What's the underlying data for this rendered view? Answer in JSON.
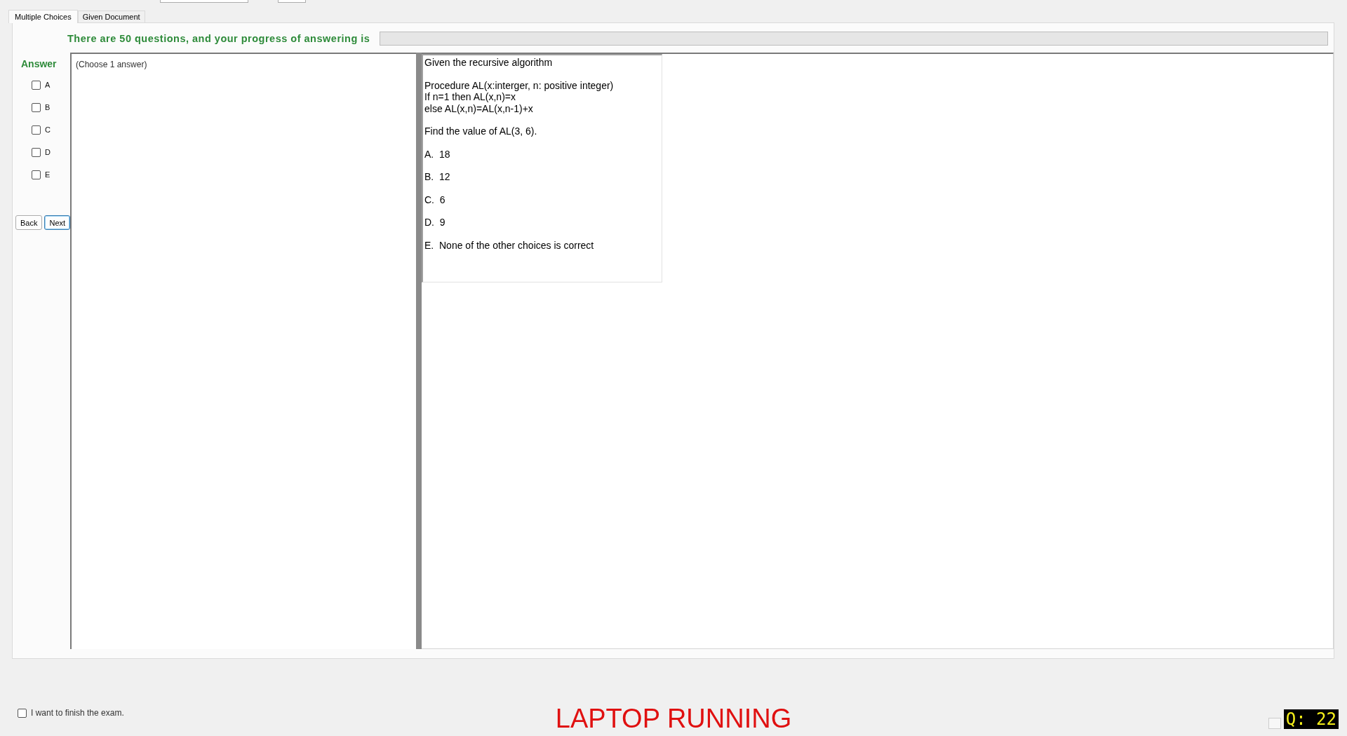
{
  "tabs": [
    {
      "label": "Multiple Choices",
      "selected": true
    },
    {
      "label": "Given Document",
      "selected": false
    }
  ],
  "progress": {
    "text": "There are 50 questions, and your progress of answering is",
    "level": 0
  },
  "answer": {
    "title": "Answer",
    "options": [
      {
        "label": "A",
        "checked": false
      },
      {
        "label": "B",
        "checked": false
      },
      {
        "label": "C",
        "checked": false
      },
      {
        "label": "D",
        "checked": false
      },
      {
        "label": "E",
        "checked": false
      }
    ]
  },
  "buttons": [
    "Back",
    "Next"
  ],
  "choose_hint": "(Choose 1 answer)",
  "question": [
    {
      "lines": [
        "Given the recursive algorithm"
      ]
    },
    {
      "lines": [
        "Procedure AL(x:interger, n: positive integer)",
        "If n=1 then AL(x,n)=x",
        "else AL(x,n)=AL(x,n-1)+x"
      ]
    },
    {
      "lines": [
        "Find the value of AL(3, 6)."
      ]
    },
    {
      "lines": [
        "A.  18"
      ]
    },
    {
      "lines": [
        "B.  12"
      ]
    },
    {
      "lines": [
        "C.  6"
      ]
    },
    {
      "lines": [
        "D.  9"
      ]
    },
    {
      "lines": [
        "E.  None of the other choices is correct"
      ]
    }
  ],
  "finish": {
    "label": "I want to finish the exam.",
    "checked": false
  },
  "status": "LAPTOP RUNNING",
  "question_number": "Q: 22"
}
